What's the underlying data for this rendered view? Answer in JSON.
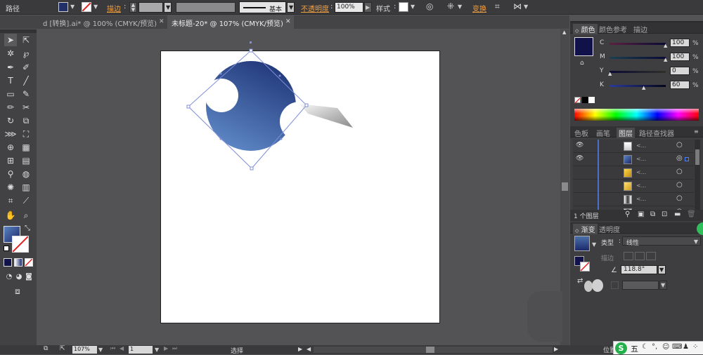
{
  "control_bar": {
    "object_type": "路径",
    "stroke_label": "描边",
    "stroke_style": "基本",
    "opacity_label": "不透明度",
    "opacity_value": "100%",
    "style_label": "样式",
    "transform_label": "变换"
  },
  "tabs": [
    {
      "label": "d [转换].ai* @ 100% (CMYK/预览)",
      "active": false
    },
    {
      "label": "未标题-20* @ 107% (CMYK/预览)",
      "active": true
    }
  ],
  "color_panel": {
    "tabs": [
      "颜色",
      "颜色参考",
      "描边"
    ],
    "fill_color": "#12124a",
    "channels": [
      {
        "name": "C",
        "value": "100"
      },
      {
        "name": "M",
        "value": "100"
      },
      {
        "name": "Y",
        "value": "0"
      },
      {
        "name": "K",
        "value": "60"
      }
    ],
    "unit": "%"
  },
  "layers_panel": {
    "tabs": [
      "色板",
      "画笔",
      "图层",
      "路径查找器"
    ],
    "rows": [
      {
        "name": "<...",
        "visible": true
      },
      {
        "name": "<...",
        "visible": true
      },
      {
        "name": "<...",
        "visible": false
      },
      {
        "name": "<...",
        "visible": false
      },
      {
        "name": "<...",
        "visible": false
      },
      {
        "name": "<...",
        "visible": false
      }
    ],
    "layer_count": "1 个图层"
  },
  "gradient_panel": {
    "tabs": [
      "渐变",
      "透明度"
    ],
    "type_label": "类型",
    "type_value": "线性",
    "stroke_label": "描边",
    "angle": "118.8°",
    "gradient_start": "#4a6fa8",
    "gradient_end": "#1c2a6c"
  },
  "status_bar": {
    "zoom": "107%",
    "page": "1",
    "tool": "选择",
    "position_label": "位置"
  },
  "colors": {
    "shape_top": "#2a3f80",
    "shape_bottom": "#5b83c0",
    "accent": "#f0a040"
  }
}
